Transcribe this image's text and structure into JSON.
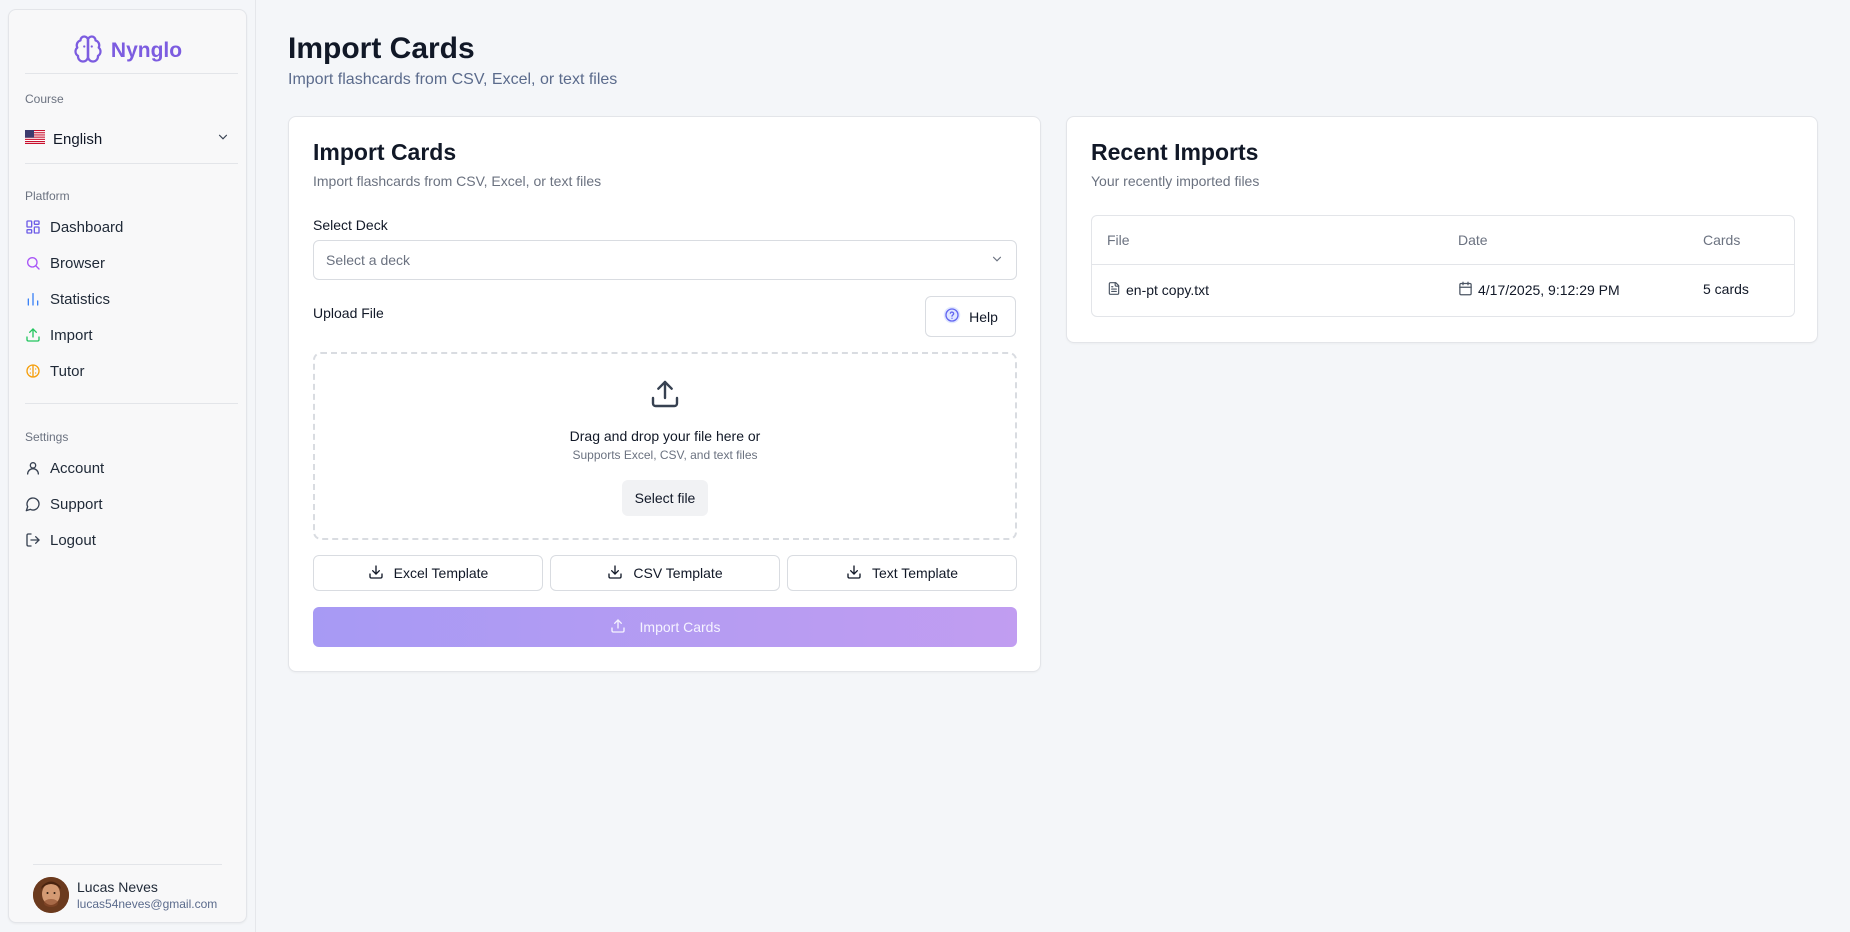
{
  "brand": {
    "name": "Nynglo",
    "color": "#7c5ce0"
  },
  "sidebar": {
    "course_section": "Course",
    "course": {
      "label": "English",
      "flag": "us-flag-icon"
    },
    "platform_section": "Platform",
    "platform_items": [
      {
        "label": "Dashboard",
        "icon": "dashboard-icon"
      },
      {
        "label": "Browser",
        "icon": "search-icon"
      },
      {
        "label": "Statistics",
        "icon": "bar-chart-icon"
      },
      {
        "label": "Import",
        "icon": "upload-icon"
      },
      {
        "label": "Tutor",
        "icon": "brain-icon"
      }
    ],
    "settings_section": "Settings",
    "settings_items": [
      {
        "label": "Account",
        "icon": "user-icon"
      },
      {
        "label": "Support",
        "icon": "message-circle-icon"
      },
      {
        "label": "Logout",
        "icon": "logout-icon"
      }
    ],
    "user": {
      "name": "Lucas Neves",
      "email": "lucas54neves@gmail.com"
    }
  },
  "header": {
    "title": "Import Cards",
    "subtitle": "Import flashcards from CSV, Excel, or text files"
  },
  "import_card": {
    "title": "Import Cards",
    "subtitle": "Import flashcards from CSV, Excel, or text files",
    "deck_label": "Select Deck",
    "deck_placeholder": "Select a deck",
    "upload_label": "Upload File",
    "help_label": "Help",
    "dropzone_text": "Drag and drop your file here or",
    "dropzone_sub": "Supports Excel, CSV, and text files",
    "select_file_label": "Select file",
    "templates": [
      "Excel Template",
      "CSV Template",
      "Text Template"
    ],
    "import_button": "Import Cards",
    "accent_gradient": [
      "#a79af4",
      "#c19df1"
    ]
  },
  "recent_card": {
    "title": "Recent Imports",
    "subtitle": "Your recently imported files",
    "columns": [
      "File",
      "Date",
      "Cards"
    ],
    "rows": [
      {
        "file": "en-pt copy.txt",
        "date": "4/17/2025, 9:12:29 PM",
        "cards": "5 cards"
      }
    ]
  }
}
